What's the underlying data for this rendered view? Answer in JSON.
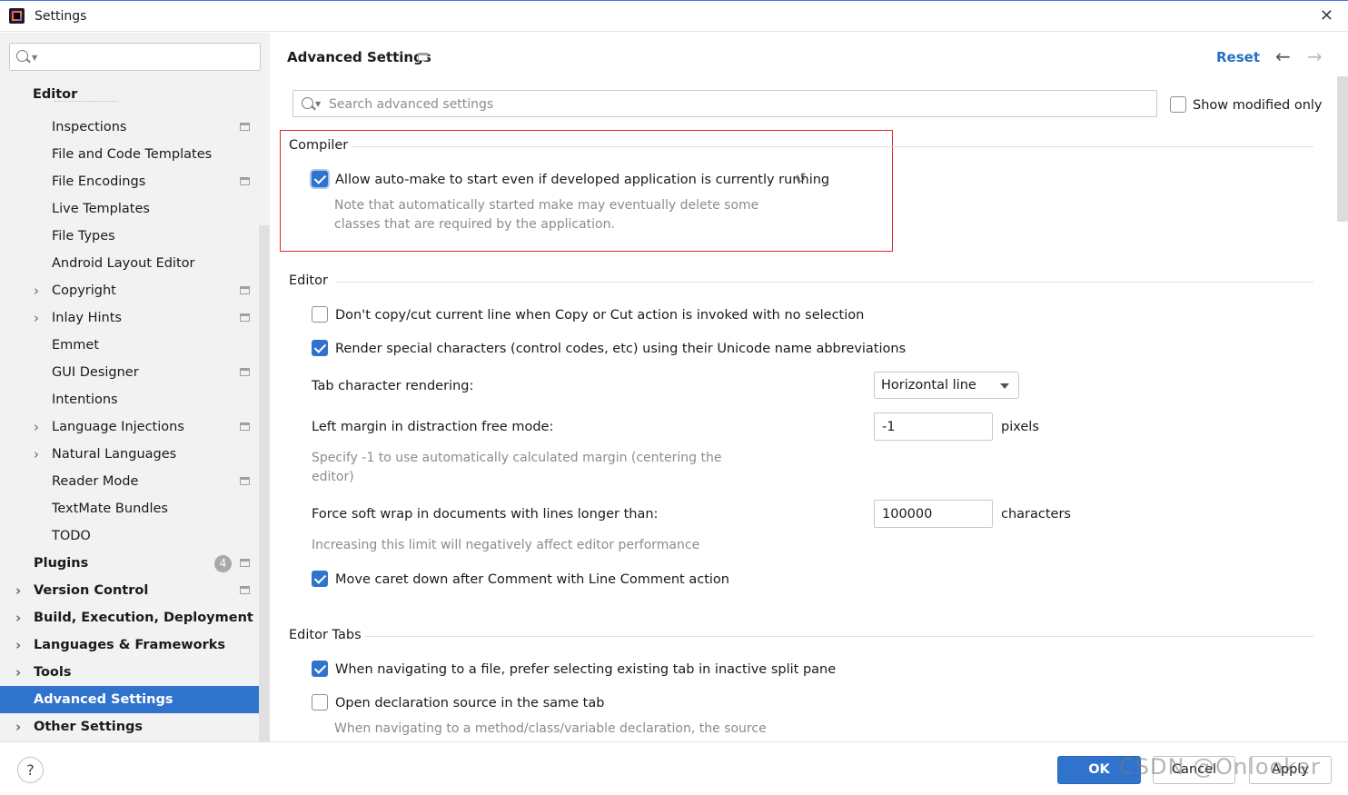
{
  "window": {
    "title": "Settings"
  },
  "sidebar": {
    "search_placeholder": "",
    "editor_header": "Editor",
    "items": [
      {
        "label": "Inspections"
      },
      {
        "label": "File and Code Templates"
      },
      {
        "label": "File Encodings"
      },
      {
        "label": "Live Templates"
      },
      {
        "label": "File Types"
      },
      {
        "label": "Android Layout Editor"
      },
      {
        "label": "Copyright"
      },
      {
        "label": "Inlay Hints"
      },
      {
        "label": "Emmet"
      },
      {
        "label": "GUI Designer"
      },
      {
        "label": "Intentions"
      },
      {
        "label": "Language Injections"
      },
      {
        "label": "Natural Languages"
      },
      {
        "label": "Reader Mode"
      },
      {
        "label": "TextMate Bundles"
      },
      {
        "label": "TODO"
      },
      {
        "label": "Plugins",
        "badge": "4"
      },
      {
        "label": "Version Control"
      },
      {
        "label": "Build, Execution, Deployment"
      },
      {
        "label": "Languages & Frameworks"
      },
      {
        "label": "Tools"
      },
      {
        "label": "Advanced Settings"
      },
      {
        "label": "Other Settings"
      }
    ]
  },
  "header": {
    "title": "Advanced Settings",
    "reset": "Reset",
    "search_placeholder": "Search advanced settings",
    "show_modified_only": "Show modified only"
  },
  "compiler": {
    "title": "Compiler",
    "auto_make_label": "Allow auto-make to start even if developed application is currently running",
    "auto_make_note_1": "Note that automatically started make may eventually delete some",
    "auto_make_note_2": "classes that are required by the application."
  },
  "editor": {
    "title": "Editor",
    "no_copy_label": "Don't copy/cut current line when Copy or Cut action is invoked with no selection",
    "render_special_label": "Render special characters (control codes, etc) using their Unicode name abbreviations",
    "tab_rendering_label": "Tab character rendering:",
    "tab_rendering_value": "Horizontal line",
    "left_margin_label": "Left margin in distraction free mode:",
    "left_margin_value": "-1",
    "left_margin_unit": "pixels",
    "left_margin_note_1": "Specify -1 to use automatically calculated margin (centering the",
    "left_margin_note_2": "editor)",
    "soft_wrap_label": "Force soft wrap in documents with lines longer than:",
    "soft_wrap_value": "100000",
    "soft_wrap_unit": "characters",
    "soft_wrap_note": "Increasing this limit will negatively affect editor performance",
    "move_caret_label": "Move caret down after Comment with Line Comment action"
  },
  "editor_tabs": {
    "title": "Editor Tabs",
    "prefer_existing_label": "When navigating to a file, prefer selecting existing tab in inactive split pane",
    "open_same_tab_label": "Open declaration source in the same tab",
    "open_same_tab_note": "When navigating to a method/class/variable declaration, the source"
  },
  "footer": {
    "help": "?",
    "ok": "OK",
    "cancel": "Cancel",
    "apply": "Apply",
    "watermark": "CSDN @Onlooker"
  },
  "colors": {
    "accent": "#2f73cd",
    "highlight_border": "#e0282e",
    "link": "#2470c2"
  }
}
